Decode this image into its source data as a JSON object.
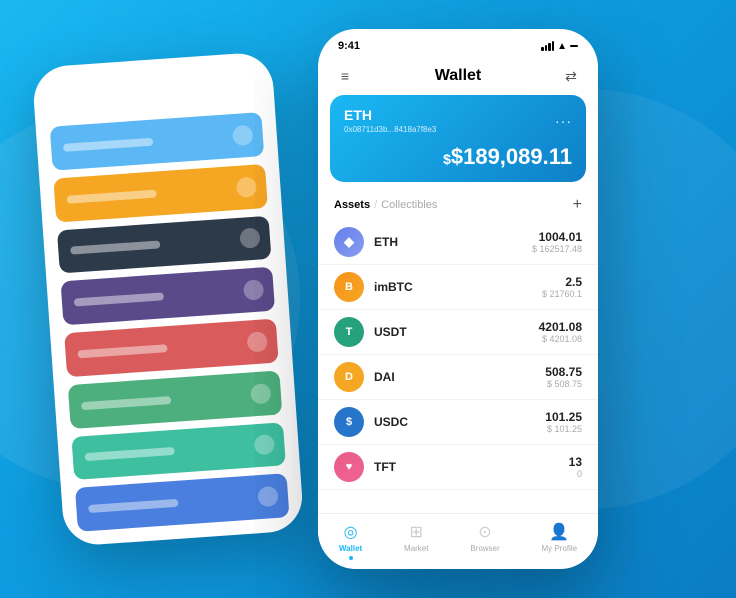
{
  "background": {
    "gradient_start": "#1ab8f3",
    "gradient_end": "#0a7dc4"
  },
  "status_bar": {
    "time": "9:41",
    "wifi": true,
    "battery": "full"
  },
  "header": {
    "title": "Wallet",
    "menu_icon": "≡",
    "transfer_icon": "⇄"
  },
  "eth_card": {
    "ticker": "ETH",
    "address": "0x08711d3b...8418a7f8e3",
    "more_icon": "···",
    "balance": "$189,089.11"
  },
  "assets_section": {
    "tab_active": "Assets",
    "tab_inactive": "Collectibles",
    "separator": "/",
    "add_icon": "+"
  },
  "assets": [
    {
      "name": "ETH",
      "icon_letter": "◆",
      "icon_class": "icon-eth",
      "amount_primary": "1004.01",
      "amount_secondary": "$ 162517.48"
    },
    {
      "name": "imBTC",
      "icon_letter": "B",
      "icon_class": "icon-imbtc",
      "amount_primary": "2.5",
      "amount_secondary": "$ 21760.1"
    },
    {
      "name": "USDT",
      "icon_letter": "T",
      "icon_class": "icon-usdt",
      "amount_primary": "4201.08",
      "amount_secondary": "$ 4201.08"
    },
    {
      "name": "DAI",
      "icon_letter": "D",
      "icon_class": "icon-dai",
      "amount_primary": "508.75",
      "amount_secondary": "$ 508.75"
    },
    {
      "name": "USDC",
      "icon_letter": "S",
      "icon_class": "icon-usdc",
      "amount_primary": "101.25",
      "amount_secondary": "$ 101.25"
    },
    {
      "name": "TFT",
      "icon_letter": "❤",
      "icon_class": "icon-tft",
      "amount_primary": "13",
      "amount_secondary": "0"
    }
  ],
  "bottom_nav": [
    {
      "label": "Wallet",
      "icon": "◎",
      "active": true
    },
    {
      "label": "Market",
      "icon": "⊞",
      "active": false
    },
    {
      "label": "Browser",
      "icon": "⊙",
      "active": false
    },
    {
      "label": "My Profile",
      "icon": "⊘",
      "active": false
    }
  ],
  "back_cards": [
    {
      "class": "card-blue"
    },
    {
      "class": "card-orange"
    },
    {
      "class": "card-dark"
    },
    {
      "class": "card-purple"
    },
    {
      "class": "card-red"
    },
    {
      "class": "card-green"
    },
    {
      "class": "card-teal"
    },
    {
      "class": "card-blue2"
    }
  ]
}
